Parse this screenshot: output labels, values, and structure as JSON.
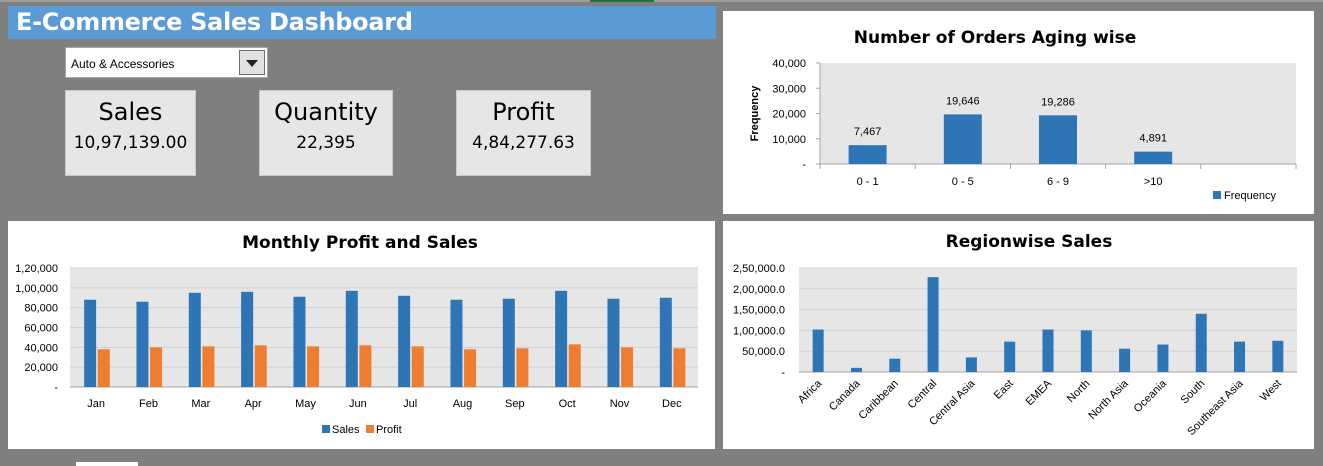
{
  "dashboard": {
    "title": "E-Commerce Sales Dashboard"
  },
  "filter": {
    "selected": "Auto & Accessories",
    "dropdown_icon": "chevron-down-icon"
  },
  "kpis": {
    "sales": {
      "label": "Sales",
      "value": "10,97,139.00"
    },
    "quantity": {
      "label": "Quantity",
      "value": "22,395"
    },
    "profit": {
      "label": "Profit",
      "value": "4,84,277.63"
    }
  },
  "colors": {
    "title_bar": "#5b9bd5",
    "background": "#7f7f7f",
    "kpi_card": "#e7e6e6",
    "sales": "#2e75b6",
    "profit": "#ed7d31",
    "plot_area": "#e7e6e6"
  },
  "chart_data": [
    {
      "type": "bar",
      "title": "Number of Orders Aging wise",
      "ylabel": "Frequency",
      "categories": [
        "0 - 1",
        "0 - 5",
        "6 - 9",
        ">10"
      ],
      "series": [
        {
          "name": "Frequency",
          "values": [
            7467,
            19646,
            19286,
            4891
          ]
        }
      ],
      "data_labels": [
        "7,467",
        "19,646",
        "19,286",
        "4,891"
      ],
      "ylim": [
        0,
        40000
      ],
      "yticks": [
        "-",
        "10,000",
        "20,000",
        "30,000",
        "40,000"
      ],
      "legend": "bottom-right",
      "grid": false
    },
    {
      "type": "bar",
      "title": "Monthly Profit and Sales",
      "categories": [
        "Jan",
        "Feb",
        "Mar",
        "Apr",
        "May",
        "Jun",
        "Jul",
        "Aug",
        "Sep",
        "Oct",
        "Nov",
        "Dec"
      ],
      "series": [
        {
          "name": "Sales",
          "values": [
            88000,
            86000,
            95000,
            96000,
            91000,
            97000,
            92000,
            88000,
            89000,
            97000,
            89000,
            90000
          ]
        },
        {
          "name": "Profit",
          "values": [
            38000,
            40000,
            41000,
            42000,
            41000,
            42000,
            41000,
            38000,
            39000,
            43000,
            40000,
            39000
          ]
        }
      ],
      "ylim": [
        0,
        120000
      ],
      "yticks": [
        "-",
        "20,000",
        "40,000",
        "60,000",
        "80,000",
        "1,00,000",
        "1,20,000"
      ],
      "legend": "bottom",
      "grid": true
    },
    {
      "type": "bar",
      "title": "Regionwise Sales",
      "categories": [
        "Africa",
        "Canada",
        "Caribbean",
        "Central",
        "Central Asia",
        "East",
        "EMEA",
        "North",
        "North Asia",
        "Oceania",
        "South",
        "Southeast Asia",
        "West"
      ],
      "series": [
        {
          "values": [
            102000,
            10000,
            32000,
            228000,
            35000,
            73000,
            102000,
            100000,
            56000,
            66000,
            140000,
            73000,
            75000
          ]
        }
      ],
      "ylim": [
        0,
        250000
      ],
      "yticks": [
        "-",
        "50,000.0",
        "1,00,000.0",
        "1,50,000.0",
        "2,00,000.0",
        "2,50,000.0"
      ],
      "legend": "none",
      "grid": true
    }
  ]
}
